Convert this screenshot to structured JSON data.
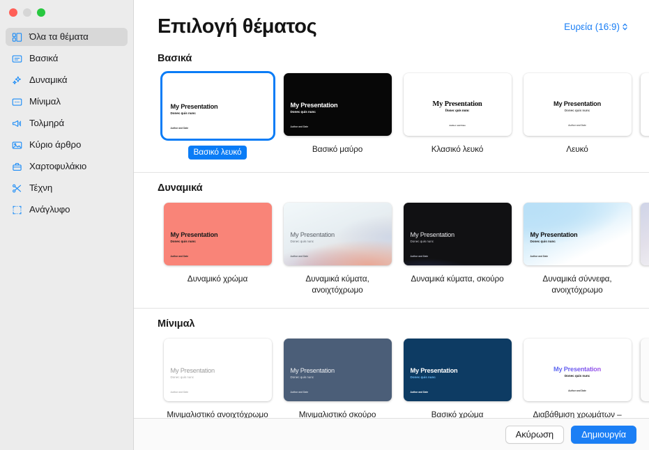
{
  "window": {
    "traffic_lights": [
      "close",
      "minimize",
      "zoom"
    ]
  },
  "sidebar": {
    "items": [
      {
        "label": "Όλα τα θέματα",
        "icon": "grid-icon",
        "selected": true
      },
      {
        "label": "Βασικά",
        "icon": "slide-lines-icon",
        "selected": false
      },
      {
        "label": "Δυναμικά",
        "icon": "sparkles-icon",
        "selected": false
      },
      {
        "label": "Μίνιμαλ",
        "icon": "slide-dots-icon",
        "selected": false
      },
      {
        "label": "Τολμηρά",
        "icon": "megaphone-icon",
        "selected": false
      },
      {
        "label": "Κύριο άρθρο",
        "icon": "photo-icon",
        "selected": false
      },
      {
        "label": "Χαρτοφυλάκιο",
        "icon": "briefcase-icon",
        "selected": false
      },
      {
        "label": "Τέχνη",
        "icon": "scissors-icon",
        "selected": false
      },
      {
        "label": "Ανάγλυφο",
        "icon": "crop-frame-icon",
        "selected": false
      }
    ]
  },
  "header": {
    "title": "Επιλογή θέματος",
    "ratio_label": "Ευρεία (16:9)",
    "ratio_icon": "chevron-updown-icon",
    "accent_color": "#1b7ff5"
  },
  "slide_text": {
    "title": "My Presentation",
    "subtitle": "Donec quis nunc",
    "footer": "Author and Date"
  },
  "sections": [
    {
      "title": "Βασικά",
      "themes": [
        {
          "name": "Βασικό λευκό",
          "selected": true
        },
        {
          "name": "Βασικό μαύρο",
          "selected": false
        },
        {
          "name": "Κλασικό λευκό",
          "selected": false
        },
        {
          "name": "Λευκό",
          "selected": false
        }
      ]
    },
    {
      "title": "Δυναμικά",
      "themes": [
        {
          "name": "Δυναμικό χρώμα",
          "selected": false
        },
        {
          "name": "Δυναμικά κύματα, ανοιχτόχρωμο",
          "selected": false
        },
        {
          "name": "Δυναμικά κύματα, σκούρο",
          "selected": false
        },
        {
          "name": "Δυναμικά σύννεφα, ανοιχτόχρωμο",
          "selected": false
        }
      ]
    },
    {
      "title": "Μίνιμαλ",
      "themes": [
        {
          "name": "Μινιμαλιστικό ανοιχτόχρωμο",
          "selected": false
        },
        {
          "name": "Μινιμαλιστικό σκούρο",
          "selected": false
        },
        {
          "name": "Βασικό χρώμα",
          "selected": false
        },
        {
          "name": "Διαβάθμιση χρωμάτων – ανοιχτόχρωμο",
          "selected": false
        }
      ]
    }
  ],
  "footer": {
    "cancel_label": "Ακύρωση",
    "create_label": "Δημιουργία"
  }
}
